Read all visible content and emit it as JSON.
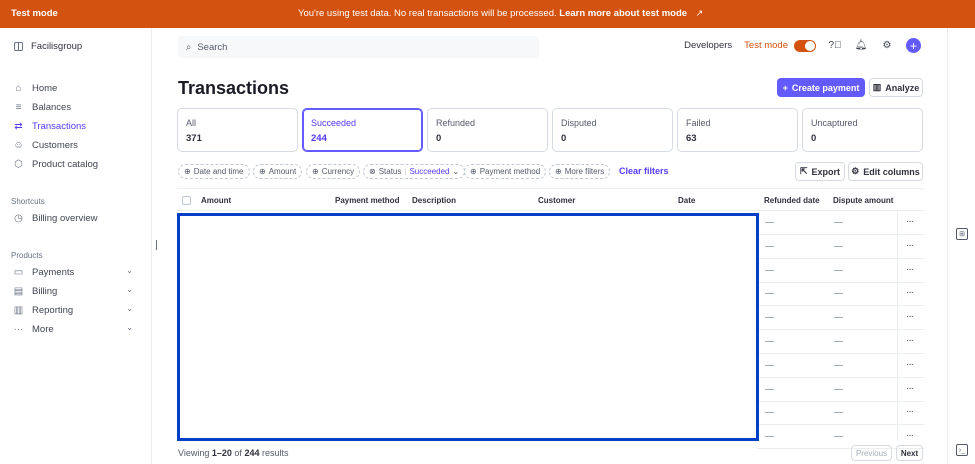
{
  "banner": {
    "mode": "Test mode",
    "message": "You're using test data. No real transactions will be processed.",
    "link": "Learn more about test mode",
    "link_icon": "external-link-icon"
  },
  "sidebar": {
    "org": "Facilisgroup",
    "items": [
      {
        "label": "Home",
        "icon": "home-icon"
      },
      {
        "label": "Balances",
        "icon": "balances-icon"
      },
      {
        "label": "Transactions",
        "icon": "transactions-icon",
        "active": true
      },
      {
        "label": "Customers",
        "icon": "customers-icon"
      },
      {
        "label": "Product catalog",
        "icon": "product-catalog-icon"
      }
    ],
    "shortcuts_label": "Shortcuts",
    "shortcuts": [
      {
        "label": "Billing overview",
        "icon": "clock-icon"
      }
    ],
    "products_label": "Products",
    "products": [
      {
        "label": "Payments",
        "icon": "payments-icon"
      },
      {
        "label": "Billing",
        "icon": "billing-icon"
      },
      {
        "label": "Reporting",
        "icon": "reporting-icon"
      },
      {
        "label": "More",
        "icon": "more-icon"
      }
    ]
  },
  "topbar": {
    "search_placeholder": "Search",
    "developers": "Developers",
    "test_mode": "Test mode"
  },
  "page": {
    "title": "Transactions",
    "create_payment": "Create payment",
    "analyze": "Analyze"
  },
  "tabs": [
    {
      "label": "All",
      "count": "371"
    },
    {
      "label": "Succeeded",
      "count": "244",
      "active": true
    },
    {
      "label": "Refunded",
      "count": "0"
    },
    {
      "label": "Disputed",
      "count": "0"
    },
    {
      "label": "Failed",
      "count": "63"
    },
    {
      "label": "Uncaptured",
      "count": "0"
    }
  ],
  "filters": {
    "date": "Date and time",
    "amount": "Amount",
    "currency": "Currency",
    "status": "Status",
    "status_value": "Succeeded",
    "payment_method": "Payment method",
    "more": "More filters",
    "clear": "Clear filters",
    "export": "Export",
    "edit_columns": "Edit columns"
  },
  "table": {
    "columns": [
      "Amount",
      "Payment method",
      "Description",
      "Customer",
      "Date",
      "Refunded date",
      "Dispute amount"
    ],
    "row_count": 10,
    "empty_value": "—"
  },
  "footer": {
    "viewing_prefix": "Viewing",
    "range": "1–20",
    "of": "of",
    "total": "244",
    "results": "results",
    "previous": "Previous",
    "next": "Next"
  },
  "colors": {
    "banner": "#d4520f",
    "accent": "#635bff",
    "highlight_border": "#0040c8"
  }
}
